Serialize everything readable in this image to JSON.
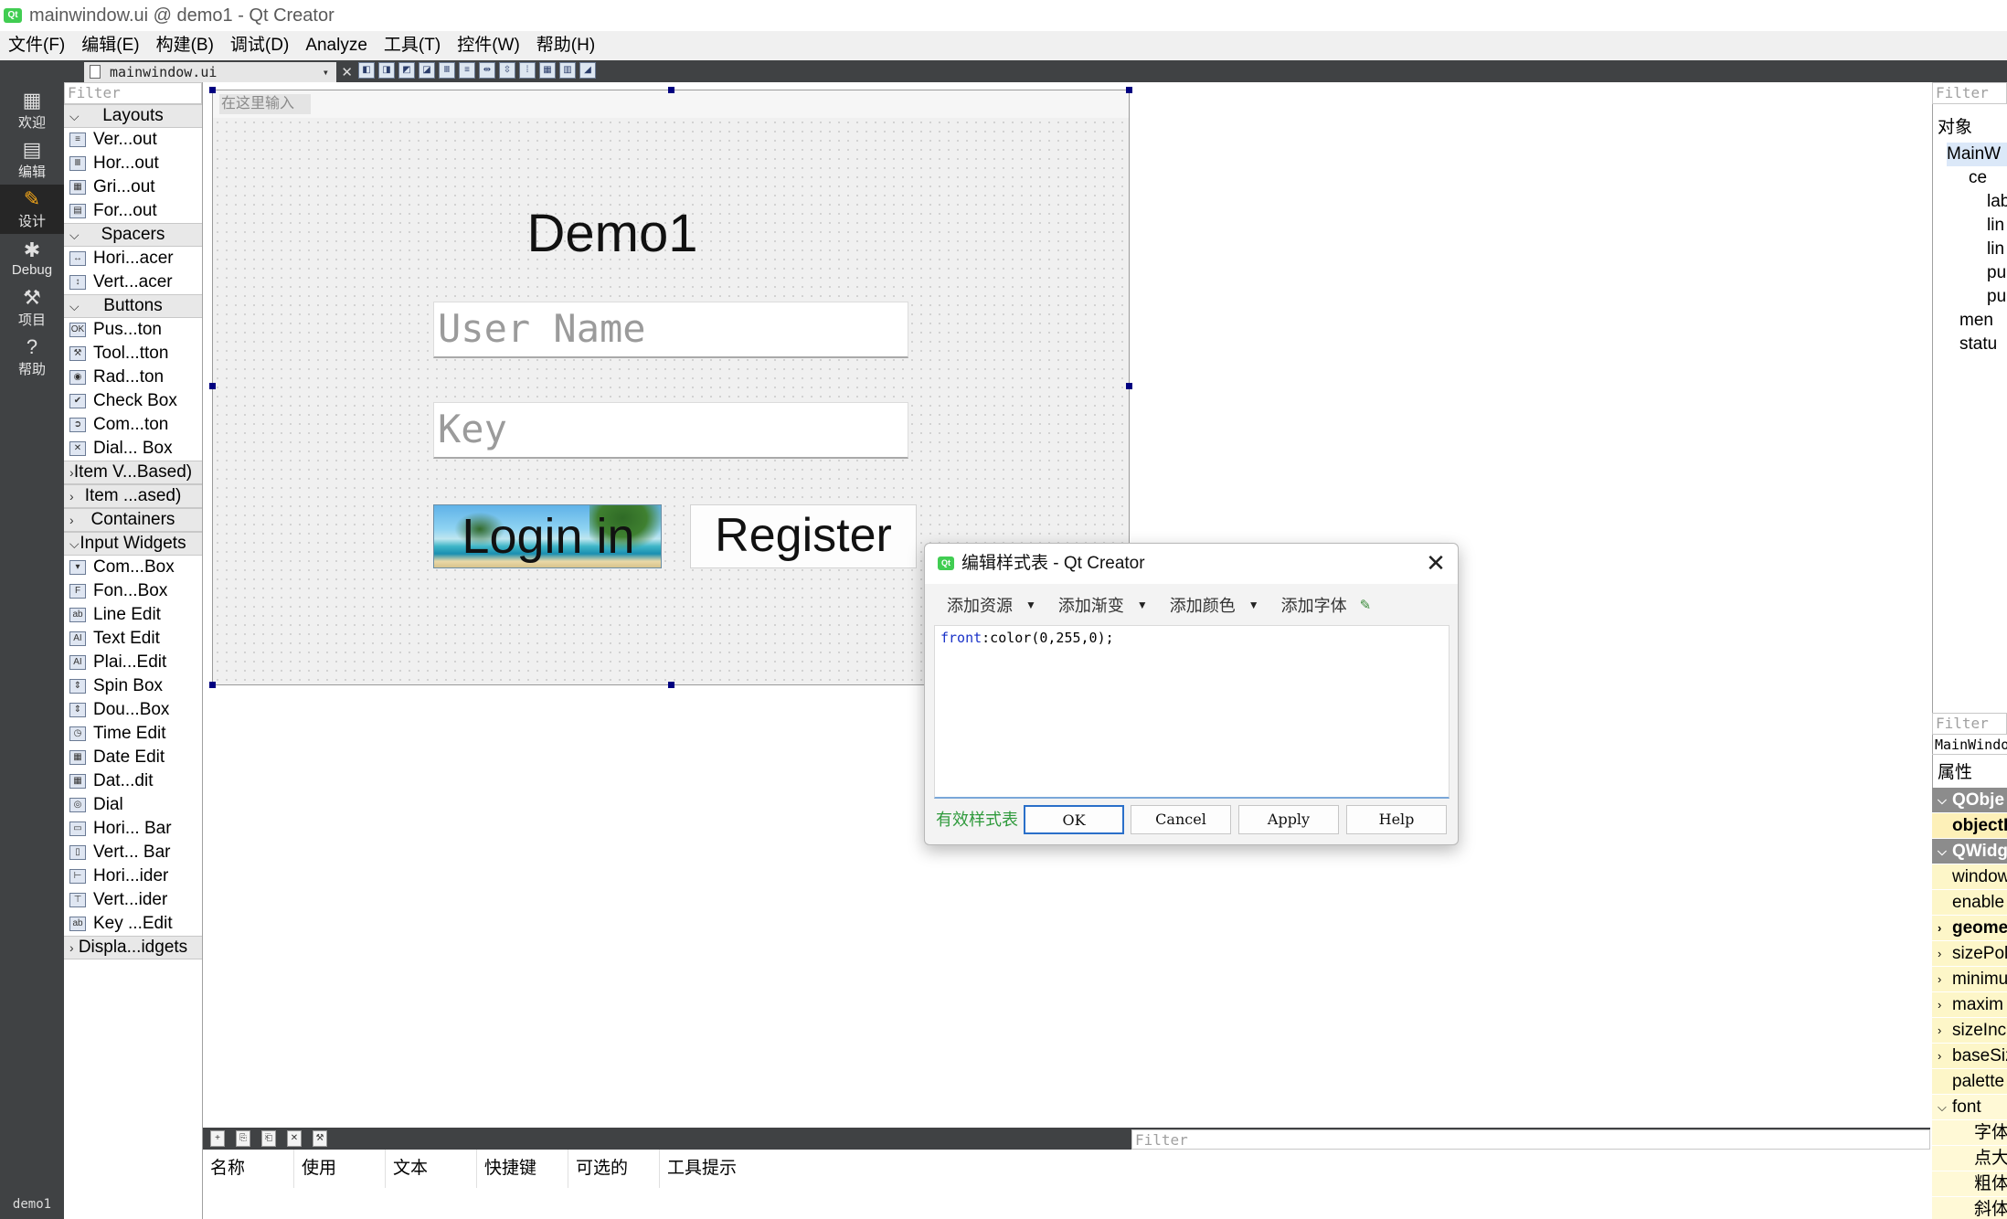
{
  "window": {
    "title": "mainwindow.ui @ demo1 - Qt Creator",
    "logo": "Qt"
  },
  "menu": [
    "文件(F)",
    "编辑(E)",
    "构建(B)",
    "调试(D)",
    "Analyze",
    "工具(T)",
    "控件(W)",
    "帮助(H)"
  ],
  "modes": [
    {
      "label": "欢迎",
      "icon": "grid-icon"
    },
    {
      "label": "编辑",
      "icon": "document-icon"
    },
    {
      "label": "设计",
      "icon": "pencil-icon",
      "active": true
    },
    {
      "label": "Debug",
      "icon": "bug-icon"
    },
    {
      "label": "项目",
      "icon": "wrench-icon"
    },
    {
      "label": "帮助",
      "icon": "help-icon"
    }
  ],
  "project_label": "demo1",
  "editor_tab": "mainwindow.ui",
  "widget_box": {
    "filter_placeholder": "Filter",
    "groups": [
      {
        "title": "Layouts",
        "expanded": true,
        "items": [
          "Ver...out",
          "Hor...out",
          "Gri...out",
          "For...out"
        ]
      },
      {
        "title": "Spacers",
        "expanded": true,
        "items": [
          "Hori...acer",
          "Vert...acer"
        ]
      },
      {
        "title": "Buttons",
        "expanded": true,
        "items": [
          "Pus...ton",
          "Tool...tton",
          "Rad...ton",
          "Check Box",
          "Com...ton",
          "Dial... Box"
        ]
      },
      {
        "title": "Item V...Based)",
        "expanded": false,
        "items": []
      },
      {
        "title": "Item ...ased)",
        "expanded": false,
        "items": []
      },
      {
        "title": "Containers",
        "expanded": false,
        "items": []
      },
      {
        "title": "Input Widgets",
        "expanded": true,
        "items": [
          "Com...Box",
          "Fon...Box",
          "Line Edit",
          "Text Edit",
          "Plai...Edit",
          "Spin Box",
          "Dou...Box",
          "Time Edit",
          "Date Edit",
          "Dat...dit",
          "Dial",
          "Hori... Bar",
          "Vert... Bar",
          "Hori...ider",
          "Vert...ider",
          "Key ...Edit"
        ]
      },
      {
        "title": "Displa...idgets",
        "expanded": false,
        "items": []
      }
    ]
  },
  "form": {
    "menu_placeholder": "在这里输入",
    "title": "Demo1",
    "username_placeholder": "User Name",
    "key_placeholder": "Key",
    "login_label": "Login in",
    "register_label": "Register"
  },
  "object_inspector": {
    "filter_placeholder": "Filter",
    "header": "对象",
    "rows": [
      "MainW",
      "ce",
      "lab",
      "lin",
      "lin",
      "pu",
      "pu",
      "men",
      "statu"
    ]
  },
  "property_editor": {
    "filter_placeholder": "Filter",
    "class_name": "MainWindo",
    "header": "属性",
    "rows": [
      "QObje",
      "objectI",
      "QWidg",
      "window",
      "enable",
      "geome",
      "sizePol",
      "minimu",
      "maxim",
      "sizeInc",
      "baseSiz",
      "palette",
      "font",
      "字体",
      "点大小",
      "粗体",
      "斜体"
    ]
  },
  "action_editor": {
    "filter_placeholder": "Filter",
    "columns": [
      "名称",
      "使用",
      "文本",
      "快捷键",
      "可选的",
      "工具提示"
    ]
  },
  "dialog": {
    "title": "编辑样式表 - Qt Creator",
    "toolbar": [
      "添加资源",
      "添加渐变",
      "添加颜色",
      "添加字体"
    ],
    "code_property": "front",
    "code_value": ":color(0,255,0);",
    "valid_text": "有效样式表",
    "buttons": {
      "ok": "OK",
      "cancel": "Cancel",
      "apply": "Apply",
      "help": "Help"
    }
  },
  "colors": {
    "accent": "#f4a71a",
    "modebar": "#404244",
    "valid": "#2f9a3c",
    "selection_handle": "#000080"
  }
}
